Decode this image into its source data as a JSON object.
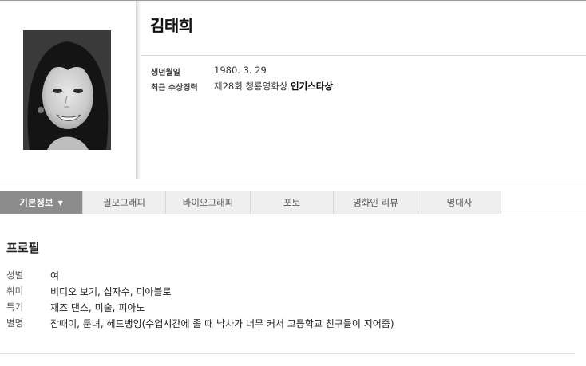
{
  "person": {
    "name": "김태희",
    "photo_icon": "portrait-photo"
  },
  "info": [
    {
      "label": "생년월일",
      "value": "1980. 3. 29"
    },
    {
      "label": "최근 수상경력",
      "value_prefix": "제28회 청룡영화상 ",
      "value_strong": "인기스타상"
    }
  ],
  "tabs": [
    {
      "label": "기본정보",
      "active": true,
      "caret": "▼"
    },
    {
      "label": "필모그래피"
    },
    {
      "label": "바이오그래피"
    },
    {
      "label": "포토"
    },
    {
      "label": "영화인 리뷰"
    },
    {
      "label": "명대사"
    }
  ],
  "profile": {
    "title": "프로필",
    "rows": [
      {
        "label": "성별",
        "value": "여"
      },
      {
        "label": "취미",
        "value": "비디오 보기, 십자수, 디아블로"
      },
      {
        "label": "특기",
        "value": "재즈 댄스, 미술, 피아노"
      },
      {
        "label": "별명",
        "value": "잠때이, 둔녀, 헤드뱅잉(수업시간에 졸 때 낙차가 너무 커서 고등학교 친구들이 지어줌)"
      }
    ]
  },
  "colors": {
    "active_tab": "#8c8c8c",
    "tab_bg": "#efefef",
    "tab_border": "#7d7d7d"
  }
}
